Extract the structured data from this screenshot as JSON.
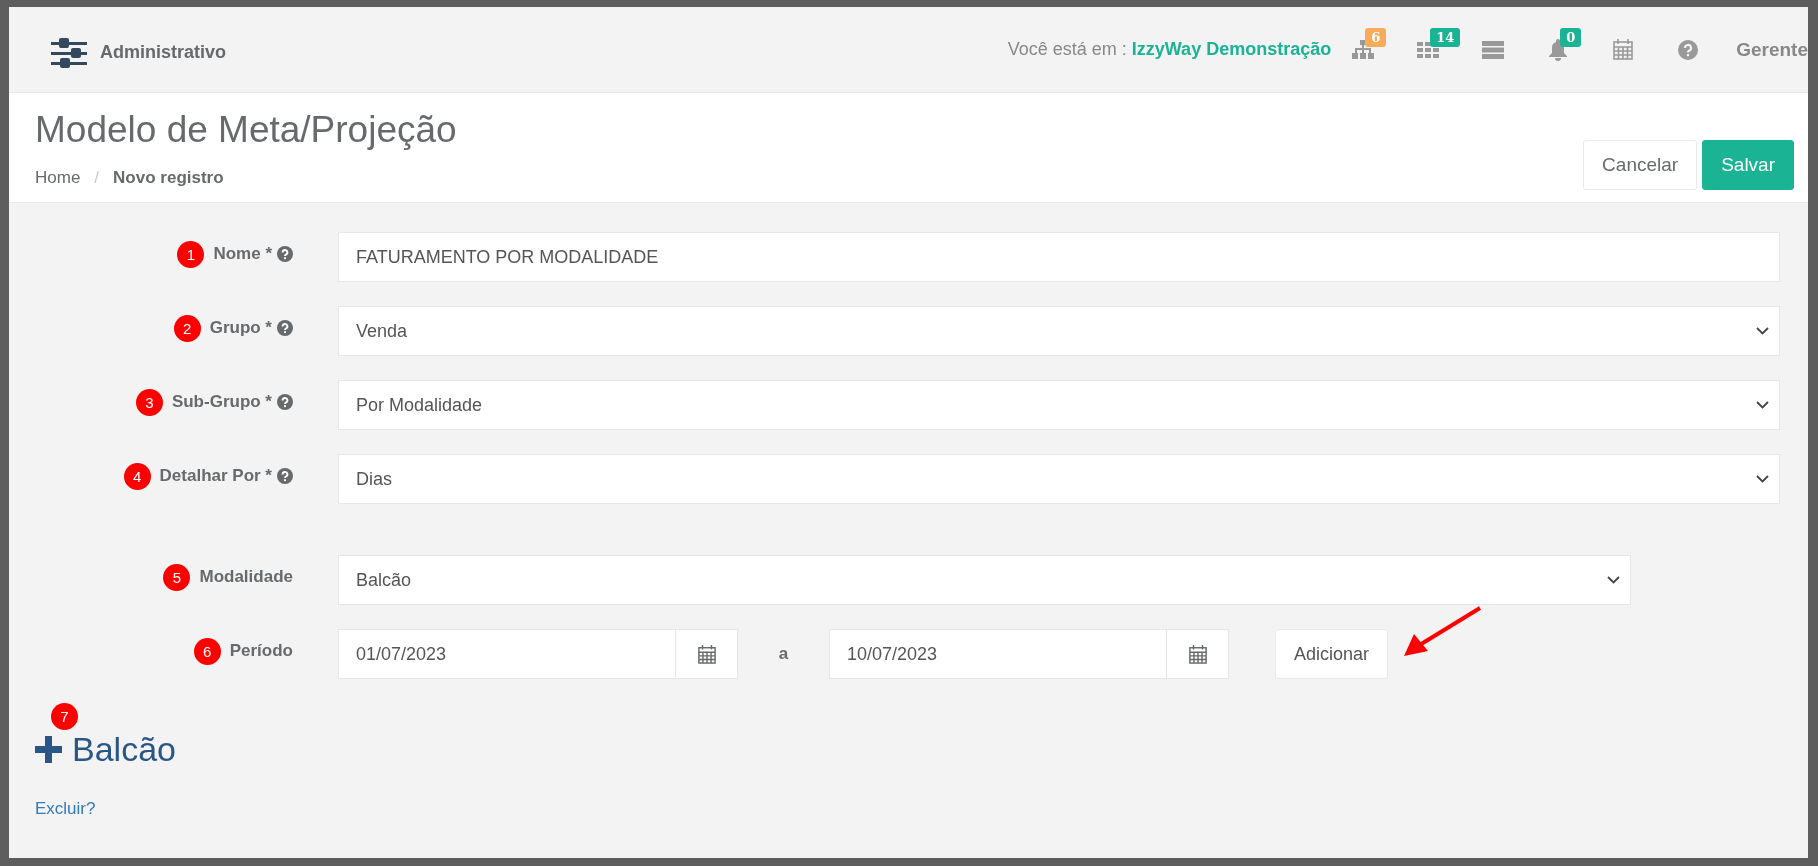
{
  "header": {
    "title": "Administrativo",
    "context_label": "Você está em :",
    "company": "IzzyWay Demonstração",
    "icons": [
      {
        "kind": "sitemap",
        "badge": "6",
        "color": "#f8ac59"
      },
      {
        "kind": "grid",
        "badge": "14",
        "color": "#1ab394"
      },
      {
        "kind": "server"
      },
      {
        "kind": "bell",
        "badge": "0",
        "color": "#1ab394"
      },
      {
        "kind": "calendar"
      },
      {
        "kind": "help"
      }
    ],
    "user": "Gerente"
  },
  "page": {
    "title": "Modelo de Meta/Projeção",
    "breadcrumb_separator": "/",
    "breadcrumb": [
      {
        "label": "Home",
        "current": false
      },
      {
        "label": "Novo registro",
        "current": true
      }
    ],
    "buttons": [
      {
        "label": "Cancelar",
        "kind": "default"
      },
      {
        "label": "Salvar",
        "kind": "primary"
      }
    ]
  },
  "form": {
    "fields": [
      {
        "marker": "1",
        "label": "Nome *",
        "help": true,
        "kind": "text",
        "value": "FATURAMENTO POR MODALIDADE"
      },
      {
        "marker": "2",
        "label": "Grupo *",
        "help": true,
        "kind": "select",
        "value": "Venda"
      },
      {
        "marker": "3",
        "label": "Sub-Grupo *",
        "help": true,
        "kind": "select",
        "value": "Por Modalidade"
      },
      {
        "marker": "4",
        "label": "Detalhar Por *",
        "help": true,
        "kind": "select",
        "value": "Dias"
      }
    ],
    "modalidade": {
      "marker": "5",
      "label": "Modalidade",
      "kind": "select",
      "value": "Balcão"
    },
    "period": {
      "marker": "6",
      "label": "Período",
      "from": "01/07/2023",
      "separator": "a",
      "to": "10/07/2023",
      "button": "Adicionar"
    }
  },
  "section": {
    "marker": "7",
    "title": "Balcão",
    "link": "Excluir?"
  }
}
